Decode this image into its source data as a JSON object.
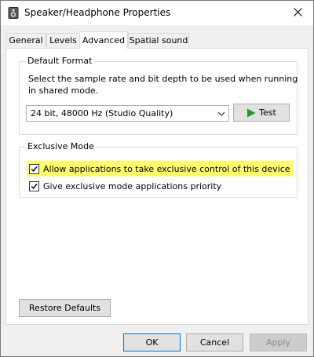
{
  "window": {
    "title": "Speaker/Headphone Properties",
    "icons": {
      "app": "speaker-icon",
      "close": "close-icon"
    }
  },
  "tabs": [
    {
      "label": "General",
      "active": false
    },
    {
      "label": "Levels",
      "active": false
    },
    {
      "label": "Advanced",
      "active": true
    },
    {
      "label": "Spatial sound",
      "active": false
    }
  ],
  "default_format": {
    "title": "Default Format",
    "description": "Select the sample rate and bit depth to be used when running in shared mode.",
    "selected_format": "24 bit, 48000 Hz (Studio Quality)",
    "test_label": "Test",
    "icons": {
      "dropdown": "chevron-down-icon",
      "test": "play-icon"
    }
  },
  "exclusive_mode": {
    "title": "Exclusive Mode",
    "options": [
      {
        "label": "Allow applications to take exclusive control of this device",
        "checked": true,
        "highlighted": true
      },
      {
        "label": "Give exclusive mode applications priority",
        "checked": true,
        "highlighted": false
      }
    ]
  },
  "restore_defaults_label": "Restore Defaults",
  "footer": {
    "ok_label": "OK",
    "cancel_label": "Cancel",
    "apply_label": "Apply",
    "apply_enabled": false
  },
  "colors": {
    "highlight": "#ffff6b",
    "accent": "#0078d7",
    "play_green": "#1e9b1e"
  }
}
